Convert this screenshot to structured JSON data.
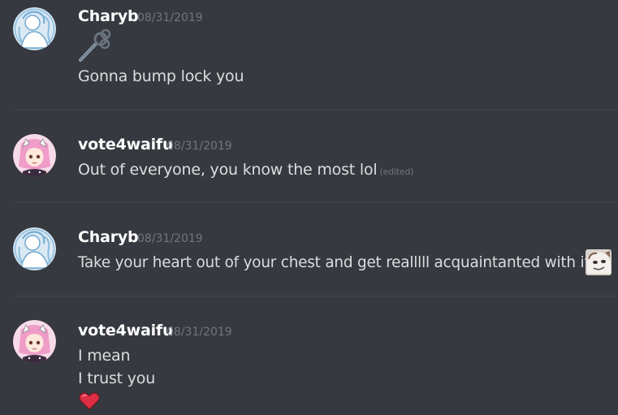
{
  "messages": [
    {
      "author": "Charyb",
      "timestamp": "08/31/2019",
      "avatar": "charyb-avatar",
      "lines": [
        "",
        "Gonna bump lock you"
      ],
      "emoji": "key-icon"
    },
    {
      "author": "vote4waifu",
      "timestamp": "08/31/2019",
      "avatar": "vote4waifu-avatar",
      "lines": [
        "Out of everyone, you know the most lol"
      ],
      "edited": "(edited)"
    },
    {
      "author": "Charyb",
      "timestamp": "08/31/2019",
      "avatar": "charyb-avatar",
      "lines": [
        "Take your heart out of your chest and get realllll acquaintanted with it"
      ],
      "emoji": "custom-face-emoji"
    },
    {
      "author": "vote4waifu",
      "timestamp": "08/31/2019",
      "avatar": "vote4waifu-avatar",
      "lines": [
        "I mean",
        "I trust you"
      ],
      "emoji": "heart-icon"
    }
  ],
  "colors": {
    "background": "#36393f",
    "username": "#ffffff",
    "timestamp": "#72767d",
    "text": "#dcddde",
    "divider": "#42454a",
    "heart": "#dd2e44"
  }
}
